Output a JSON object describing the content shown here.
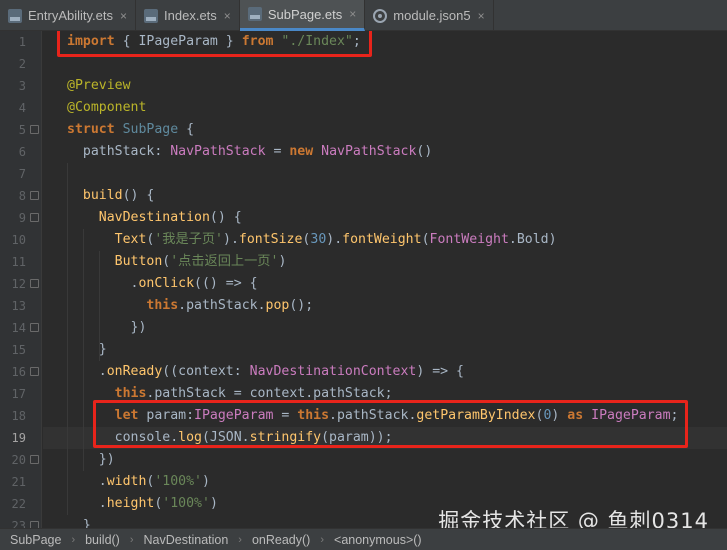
{
  "tabs": [
    {
      "label": "EntryAbility.ets",
      "icon": "ets-file-icon",
      "active": false
    },
    {
      "label": "Index.ets",
      "icon": "ets-file-icon",
      "active": false
    },
    {
      "label": "SubPage.ets",
      "icon": "ets-file-icon",
      "active": true
    },
    {
      "label": "module.json5",
      "icon": "json-file-icon",
      "active": false
    }
  ],
  "close_glyph": "×",
  "line_numbers": [
    "1",
    "2",
    "3",
    "4",
    "5",
    "6",
    "7",
    "8",
    "9",
    "10",
    "11",
    "12",
    "13",
    "14",
    "15",
    "16",
    "17",
    "18",
    "19",
    "20",
    "21",
    "22",
    "23"
  ],
  "current_line": 19,
  "code_lines": [
    [
      [
        "kw",
        "import"
      ],
      [
        "plain",
        " { IPageParam } "
      ],
      [
        "kw",
        "from"
      ],
      [
        "plain",
        " "
      ],
      [
        "str",
        "\"./Index\""
      ],
      [
        "plain",
        ";"
      ]
    ],
    [],
    [
      [
        "ann",
        "@Preview"
      ]
    ],
    [
      [
        "ann",
        "@Component"
      ]
    ],
    [
      [
        "kw",
        "struct"
      ],
      [
        "plain",
        " "
      ],
      [
        "cls",
        "SubPage"
      ],
      [
        "plain",
        " {"
      ]
    ],
    [
      [
        "plain",
        "  "
      ],
      [
        "plain",
        "pathStack: "
      ],
      [
        "type",
        "NavPathStack"
      ],
      [
        "plain",
        " = "
      ],
      [
        "kw",
        "new"
      ],
      [
        "plain",
        " "
      ],
      [
        "type",
        "NavPathStack"
      ],
      [
        "plain",
        "()"
      ]
    ],
    [],
    [
      [
        "plain",
        "  "
      ],
      [
        "fn",
        "build"
      ],
      [
        "plain",
        "() {"
      ]
    ],
    [
      [
        "plain",
        "    "
      ],
      [
        "fn",
        "NavDestination"
      ],
      [
        "plain",
        "() {"
      ]
    ],
    [
      [
        "plain",
        "      "
      ],
      [
        "fn",
        "Text"
      ],
      [
        "plain",
        "("
      ],
      [
        "str",
        "'我是子页'"
      ],
      [
        "plain",
        ")."
      ],
      [
        "fn",
        "fontSize"
      ],
      [
        "plain",
        "("
      ],
      [
        "num",
        "30"
      ],
      [
        "plain",
        ")."
      ],
      [
        "fn",
        "fontWeight"
      ],
      [
        "plain",
        "("
      ],
      [
        "type",
        "FontWeight"
      ],
      [
        "plain",
        ".Bold)"
      ]
    ],
    [
      [
        "plain",
        "      "
      ],
      [
        "fn",
        "Button"
      ],
      [
        "plain",
        "("
      ],
      [
        "str",
        "'点击返回上一页'"
      ],
      [
        "plain",
        ")"
      ]
    ],
    [
      [
        "plain",
        "        ."
      ],
      [
        "fn",
        "onClick"
      ],
      [
        "plain",
        "(() => {"
      ]
    ],
    [
      [
        "plain",
        "          "
      ],
      [
        "kw",
        "this"
      ],
      [
        "plain",
        ".pathStack."
      ],
      [
        "fn",
        "pop"
      ],
      [
        "plain",
        "();"
      ]
    ],
    [
      [
        "plain",
        "        })"
      ]
    ],
    [
      [
        "plain",
        "    }"
      ]
    ],
    [
      [
        "plain",
        "    ."
      ],
      [
        "fn",
        "onReady"
      ],
      [
        "plain",
        "((context: "
      ],
      [
        "type",
        "NavDestinationContext"
      ],
      [
        "plain",
        ") => {"
      ]
    ],
    [
      [
        "plain",
        "      "
      ],
      [
        "kw",
        "this"
      ],
      [
        "plain",
        ".pathStack = context.pathStack;"
      ]
    ],
    [
      [
        "plain",
        "      "
      ],
      [
        "kw",
        "let"
      ],
      [
        "plain",
        " param:"
      ],
      [
        "type",
        "IPageParam"
      ],
      [
        "plain",
        " = "
      ],
      [
        "kw",
        "this"
      ],
      [
        "plain",
        ".pathStack."
      ],
      [
        "fn",
        "getParamByIndex"
      ],
      [
        "plain",
        "("
      ],
      [
        "num",
        "0"
      ],
      [
        "plain",
        ") "
      ],
      [
        "kw",
        "as"
      ],
      [
        "plain",
        " "
      ],
      [
        "type",
        "IPageParam"
      ],
      [
        "plain",
        ";"
      ]
    ],
    [
      [
        "plain",
        "      console."
      ],
      [
        "fn",
        "log"
      ],
      [
        "plain",
        "(JSON."
      ],
      [
        "fn",
        "stringify"
      ],
      [
        "plain",
        "(param));"
      ]
    ],
    [
      [
        "plain",
        "    })"
      ]
    ],
    [
      [
        "plain",
        "    ."
      ],
      [
        "fn",
        "width"
      ],
      [
        "plain",
        "("
      ],
      [
        "str",
        "'100%'"
      ],
      [
        "plain",
        ")"
      ]
    ],
    [
      [
        "plain",
        "    ."
      ],
      [
        "fn",
        "height"
      ],
      [
        "plain",
        "("
      ],
      [
        "str",
        "'100%'"
      ],
      [
        "plain",
        ")"
      ]
    ],
    [
      [
        "plain",
        "  }"
      ]
    ]
  ],
  "highlight_color": "#e8241b",
  "watermark": "掘金技术社区 @ 鱼刺0314",
  "breadcrumb": [
    "SubPage",
    "build()",
    "NavDestination",
    "onReady()",
    "<anonymous>()"
  ],
  "breadcrumb_separator": "›"
}
